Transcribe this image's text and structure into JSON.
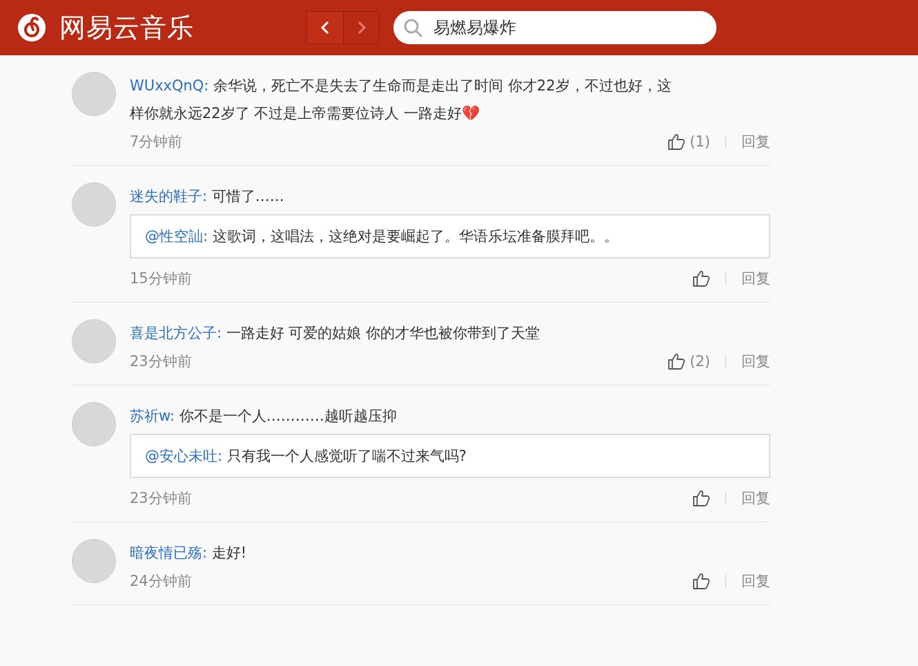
{
  "header": {
    "logo_text": "网易云音乐",
    "nav": [
      {
        "kind": "back",
        "disabled": false
      },
      {
        "kind": "forward",
        "disabled": true
      }
    ],
    "search": {
      "value": "易燃易爆炸"
    }
  },
  "comments": [
    {
      "user": "WUxxQnQ:",
      "text": "余华说，死亡不是失去了生命而是走出了时间 你才22岁，不过也好，这样你就永远22岁了 不过是上帝需要位诗人 一路走好💔",
      "time": "7分钟前",
      "likes": "(1)",
      "reply_label": "回复"
    },
    {
      "user": "迷失的鞋子:",
      "text": "可惜了……",
      "quote": {
        "user": "@性空訕:",
        "text": "这歌词，这唱法，这绝对是要崛起了。华语乐坛准备膜拜吧。。"
      },
      "time": "15分钟前",
      "reply_label": "回复"
    },
    {
      "user": "喜是北方公子:",
      "text": "一路走好 可爱的姑娘 你的才华也被你带到了天堂",
      "time": "23分钟前",
      "likes": "(2)",
      "reply_label": "回复"
    },
    {
      "user": "苏祈w:",
      "text": "你不是一个人…………越听越压抑",
      "quote": {
        "user": "@安心未吐:",
        "text": "只有我一个人感觉听了喘不过来气吗?"
      },
      "time": "23分钟前",
      "reply_label": "回复"
    },
    {
      "user": "暗夜情已殇:",
      "text": "走好!",
      "time": "24分钟前",
      "reply_label": "回复"
    }
  ]
}
